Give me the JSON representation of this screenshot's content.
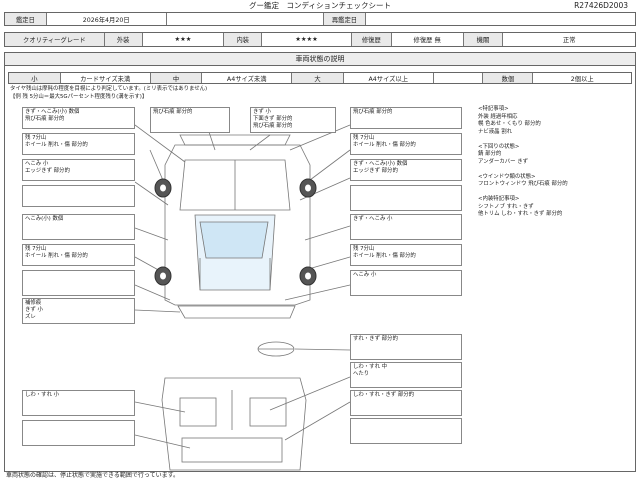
{
  "header": {
    "title": "グー鑑定　コンディションチェックシート",
    "doc_no": "R27426D2003"
  },
  "row1": {
    "date_label": "鑑定日",
    "date_value": "2026年4月20日",
    "reappraisal_label": "再鑑定日",
    "reappraisal_value": ""
  },
  "row2": {
    "grade_label": "クオリティーグレード",
    "exterior_label": "外装",
    "exterior_stars": "★★★",
    "interior_label": "内装",
    "interior_stars": "★★★★",
    "repair_label": "修復歴",
    "repair_value": "修復歴 無",
    "equipment_label": "機關",
    "equipment_value": "正常"
  },
  "section": {
    "title": "車両状態の説明"
  },
  "legend": {
    "small": "小",
    "small_desc": "カードサイズ未満",
    "medium": "中",
    "medium_desc": "A4サイズ未満",
    "large": "大",
    "large_desc": "A4サイズ以上",
    "count_label": "数個",
    "count_desc": "2個以上"
  },
  "tire_notes": {
    "line1": "タイヤ残山は摩耗の程度を目視により判定しています。(ミリ表示ではありません)",
    "line2": "【例 残 5分山＝最大5Gパーセント程度残り(溝を示す)】"
  },
  "left_boxes": [
    "きず・へこみ(小) 数個\n飛び石痕 部分的",
    "残 7分山\nホイール 削れ・傷 部分的",
    "へこみ 小\nエッジきず 部分的",
    "",
    "へこみ(小) 数個",
    "残 7分山\nホイール 削れ・傷 部分的",
    "",
    "補修痕\nきず 小\nズレ"
  ],
  "top_boxes": [
    "飛び石痕 部分的",
    "きず 小\n下面きず 部分的\n飛び石痕 部分的",
    "飛び石痕 部分的"
  ],
  "right_boxes": [
    "残 7分山\nホイール 削れ・傷 部分的",
    "きず・へこみ(小) 数個\nエッジきず 部分的",
    "",
    "きず・へこみ 小",
    "残 7分山\nホイール 削れ・傷 部分的",
    "へこみ 小"
  ],
  "interior_right_boxes": [
    "すれ・きず 部分的",
    "しわ・すれ 中\nへたり",
    "しわ・すれ・きず 部分的",
    ""
  ],
  "interior_left_boxes": [
    "しわ・すれ 小",
    ""
  ],
  "side_text": "<特記事項>\n外装 経過年相応\n幌 色あせ・くもり 部分的\nナビ液晶 割れ\n\n<下回りの状態>\n錆 部分的\nアンダーカバー きず\n\n<ウインドウ類の状態>\nフロントウィンドウ 飛び石痕 部分的\n\n<内装特記事項>\nシフトノブ すれ・きず\n他トリム しわ・すれ・きず 部分的",
  "footer": {
    "text": "車両状態の確認は、停止状態で実施できる範囲で行っています。"
  }
}
